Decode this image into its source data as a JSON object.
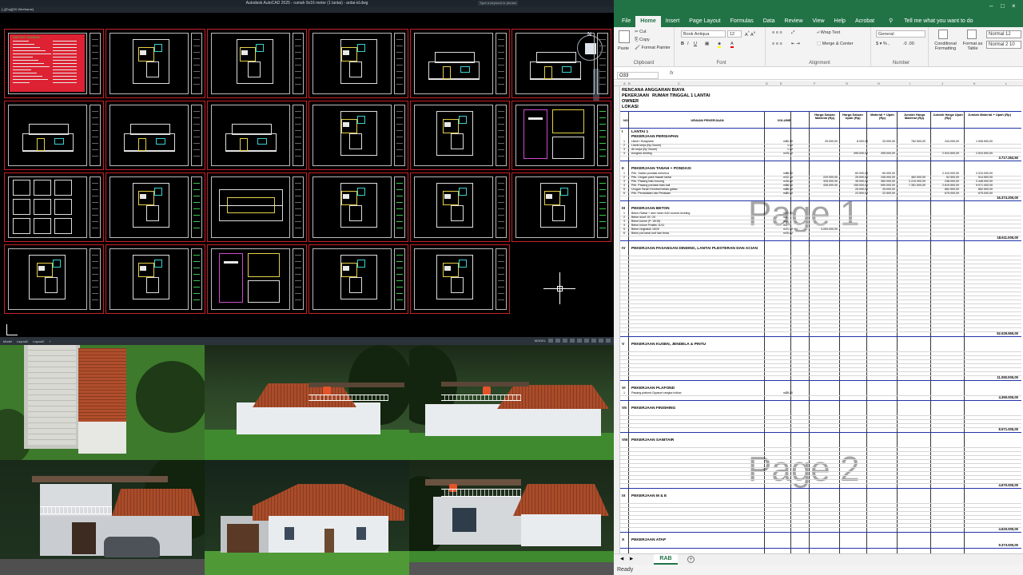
{
  "cad": {
    "title": "Autodesk AutoCAD 2025 - rumah 9x16 meter (1 lantai) - ardai-id.dwg",
    "search": "Type a keyword or phrase",
    "viewport_label": "[–][Top][2D Wireframe]",
    "viewcube_north": "N",
    "viewcube_face": "TOP",
    "layout_tabs": [
      "Model",
      "Layout1",
      "Layout2",
      "+"
    ],
    "status": "MODEL",
    "first_sheet_heading": "DAFTAR GAMBAR"
  },
  "excel": {
    "ribbon_tabs": [
      "File",
      "Home",
      "Insert",
      "Page Layout",
      "Formulas",
      "Data",
      "Review",
      "View",
      "Help",
      "Acrobat"
    ],
    "active_tab": "Home",
    "tell_me": "Tell me what you want to do",
    "clipboard": {
      "paste": "Paste",
      "cut": "Cut",
      "copy": "Copy",
      "format_painter": "Format Painter",
      "label": "Clipboard"
    },
    "font": {
      "name": "Book Antiqua",
      "size": "12",
      "label": "Font"
    },
    "alignment": {
      "wrap": "Wrap Text",
      "merge": "Merge & Center",
      "label": "Alignment"
    },
    "number": {
      "format": "General",
      "label": "Number"
    },
    "styles": {
      "conditional": "Conditional Formatting",
      "format_table": "Format as Table",
      "normal12": "Normal 12",
      "normal210": "Normal 2 10"
    },
    "name_box": "O33",
    "fx": "fx",
    "sheet_tab": "RAB",
    "status": "Ready",
    "watermarks": [
      "Page 1",
      "Page 2"
    ],
    "header": {
      "title": "RENCANA ANGGARAN BIAYA",
      "pekerjaan": "PEKERJAAN",
      "pekerjaan_val": "RUMAH TINGGAL 1 LANTAI",
      "owner": "OWNER",
      "lokasi": "LOKASI"
    },
    "columns": [
      "NO",
      "URAIAN PEKERJAAN",
      "VOLUME",
      "Harga Satuan Material (Rp)",
      "Harga Satuan Upah (Rp)",
      "Material + Upah (Rp)",
      "Jumlah Harga Material (Rp)",
      "Jumlah Harga Upah (Rp)",
      "Jumlah Material + Upah (Rp)"
    ],
    "col_letters": [
      "A",
      "B",
      "C",
      "D",
      "E",
      "F",
      "G",
      "H",
      "I",
      "J",
      "K",
      "L"
    ],
    "sections": [
      {
        "no": "I",
        "name": "LANTAI 1",
        "sub": "PEKERJAAN PERSIAPAN",
        "items": [
          [
            "1",
            "Uitzet / Bowplank",
            "30,50",
            "m1",
            "25.000,00",
            "8.000,00",
            "33.000,00",
            "762.500,00",
            "244.000,00",
            "1.006.500,00"
          ],
          [
            "2",
            "Listrik kerja (By Owner)",
            "1,00",
            "",
            "",
            "",
            "",
            "",
            "",
            ""
          ],
          [
            "3",
            "Air kerja (By Owner)",
            "1,00",
            "",
            "",
            "",
            "",
            "",
            "",
            ""
          ],
          [
            "4",
            "bongkar dinding",
            "5,10",
            "m3",
            "",
            "495.000,00",
            "495.000,00",
            "",
            "2.524.500,00",
            "2.524.500,00"
          ]
        ],
        "total": "3.717.262,50"
      },
      {
        "no": "II",
        "name": "PEKERJAAN TANAH + PONDASI",
        "items": [
          [
            "1",
            "Pek. Galian pondasi menerus",
            "38,50",
            "m3",
            "",
            "60.000,00",
            "60.000,00",
            "",
            "2.310.000,00",
            "2.310.000,00"
          ],
          [
            "2",
            "Pek. Urugan pasir bawah lantai",
            "2,10",
            "m3",
            "220.000,00",
            "25.000,00",
            "245.000,00",
            "462.000,00",
            "52.500,00",
            "514.500,00"
          ],
          [
            "3",
            "Pek. Pasang batu kosong",
            "6,80",
            "m3",
            "325.000,00",
            "35.000,00",
            "360.000,00",
            "2.210.000,00",
            "238.000,00",
            "2.448.000,00"
          ],
          [
            "4",
            "Pek. Pasang pondasi batu kali",
            "16,90",
            "m3",
            "435.000,00",
            "155.000,00",
            "590.000,00",
            "7.351.500,00",
            "2.619.500,00",
            "9.971.000,00"
          ],
          [
            "5",
            "Urugan Tanah Kembali bekas galian",
            "26,50",
            "m3",
            "",
            "25.000,00",
            "25.000,00",
            "",
            "662.500,00",
            "662.500,00"
          ],
          [
            "6",
            "Pek. Pemadatan dan Perataan",
            "30,00",
            "m2",
            "",
            "22.500,00",
            "22.500,00",
            "",
            "675.000,00",
            "675.000,00"
          ]
        ],
        "total": "16.374.200,00"
      },
      {
        "no": "III",
        "name": "PEKERJAAN BETON",
        "items": [
          [
            "1",
            "Beton Rabat + wire mesh M10 screed leveling",
            "7,50",
            "m2",
            "",
            "",
            "",
            "",
            "",
            ""
          ],
          [
            "2",
            "Beton sloof 15 / 20",
            "",
            "m3",
            "",
            "",
            "",
            "",
            "",
            ""
          ],
          [
            "3",
            "Beton kolom (P. 15/15)",
            "",
            "m3",
            "",
            "",
            "",
            "",
            "",
            ""
          ],
          [
            "4",
            "Beton kolom Praktis 11/11",
            "",
            "m3",
            "",
            "",
            "",
            "",
            "",
            ""
          ],
          [
            "5",
            "Beton ringbalok 15/20",
            "1,90",
            "m3",
            "3.000.000,00",
            "",
            "",
            "",
            "",
            ""
          ],
          [
            "6",
            "Beton pot lanai roof dan teras",
            "0,82",
            "m3",
            "",
            "",
            "",
            "",
            "",
            ""
          ]
        ],
        "total": "18.611.000,00"
      },
      {
        "no": "IV",
        "name": "PEKERJAAN PASANGAN DINDING, LANTAI PLESTERAN DAN ACIAN",
        "items": [],
        "total": "52.029.550,00"
      },
      {
        "no": "V",
        "name": "PEKERJAAN KUSEN, JENDELA & PINTU",
        "items": [],
        "total": "11.050.000,00"
      },
      {
        "no": "VI",
        "name": "PEKERJAAN PLAFOND",
        "items": [
          [
            "1",
            "Pasang plafond Gypsum rangka hollow",
            "28,00",
            "m2",
            "",
            "",
            "",
            "",
            "",
            ""
          ]
        ],
        "total": "4.350.000,00"
      },
      {
        "no": "VII",
        "name": "PEKERJAAN FINISHING",
        "items": [],
        "total": "8.571.000,00"
      },
      {
        "no": "VIII",
        "name": "PEKERJAAN SANITAIR",
        "items": [],
        "total": "4.670.000,00"
      },
      {
        "no": "IX",
        "name": "PEKERJAAN M & E",
        "items": [],
        "total": "4.620.000,00"
      },
      {
        "no": "X",
        "name": "PEKERJAAN ATAP",
        "items": [],
        "total": "9.373.000,00"
      },
      {
        "no": "XI",
        "name": "PEKERJAAN LAIN-LAIN",
        "items": []
      }
    ]
  }
}
